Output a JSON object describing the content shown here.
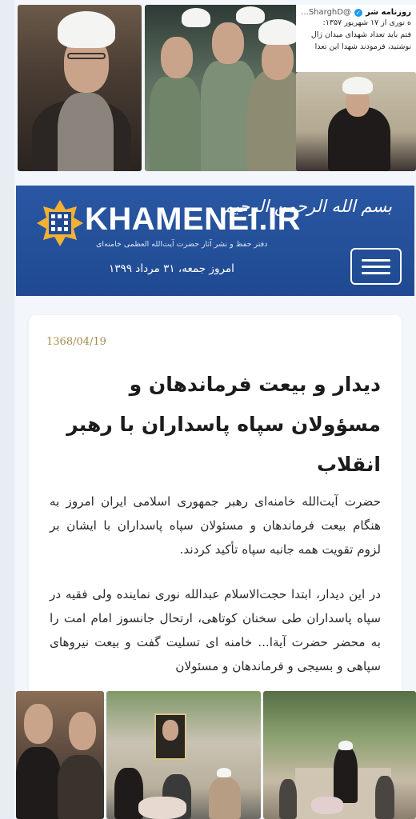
{
  "tweet": {
    "account_name": "روزنامه شر",
    "handle": "@SharghD...",
    "lines": [
      "ه نوری از ۱۷ شهریور ۱۳۵۷:",
      "فتم باید تعداد شهدای میدان ژال",
      "نوشتید، فرمودند شهدا این تعدا"
    ]
  },
  "banner": {
    "logo_text": "KHAMENEI.IR",
    "logo_subtitle": "دفتر حفظ و نشر آثار حضرت آیت‌الله العظمی خامنه‌ای",
    "bismillah": "بسم الله الرحمن الرحیم",
    "date_line": "امروز جمعه، ۳۱ مرداد ۱۳۹۹",
    "menu_icon": "hamburger-menu-icon"
  },
  "article": {
    "date": "1368/04/19",
    "title": "دیدار و بیعت فرماندهان و مسؤولان سپاه پاسداران با رهبر انقلاب",
    "paragraph1": "حضرت آیت‌الله خامنه‌ای رهبر جمهوری اسلامی ایران امروز به هنگام بیعت فرماندهان و مسئولان سپاه پاسداران با ایشان بر لزوم تقویت همه جانبه سپاه تأکید کردند.",
    "paragraph2": "در این دیدار، ابتدا حجت‌الاسلام عبدالله نوری نماینده ولی فقیه در سپاه پاسداران طی سخنان کوتاهی، ارتحال جانسوز امام امت را به محضر حضرت آیةا... خامنه ای تسلیت گفت و بیعت نیروهای سپاهی و بسیجی و فرماندهان و مسئولان"
  },
  "colors": {
    "banner_blue": "#1f4a92",
    "date_gold": "#a58a4a",
    "page_bg": "#e8edf3"
  }
}
